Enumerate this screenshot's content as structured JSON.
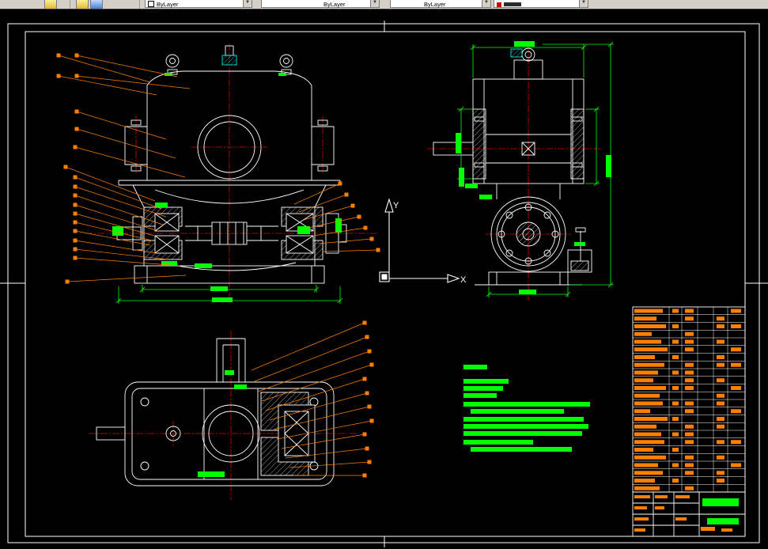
{
  "toolbar": {
    "combos": [
      {
        "label": "ByLayer"
      },
      {
        "label": "ByLayer"
      },
      {
        "label": "ByLayer"
      },
      {
        "label": ""
      }
    ]
  },
  "ucs": {
    "x_label": "X",
    "y_label": "Y"
  },
  "colors": {
    "line": "#ffffff",
    "centerline": "#dd0000",
    "dimension": "#00ff00",
    "annotation": "#ff7f00",
    "fitting": "#00ffff",
    "table_text": "#ff7f00"
  },
  "annotations": {
    "bars": [
      [
        142,
        286,
        14,
        12,
        "g"
      ],
      [
        196,
        256,
        16,
        6,
        "g"
      ],
      [
        204,
        330,
        20,
        6,
        "g"
      ],
      [
        246,
        333,
        22,
        6,
        "g"
      ],
      [
        266,
        362,
        22,
        6,
        "g"
      ],
      [
        268,
        376,
        26,
        6,
        "g"
      ],
      [
        376,
        286,
        16,
        10,
        "g"
      ],
      [
        424,
        276,
        8,
        18,
        "g"
      ],
      [
        208,
        92,
        10,
        4,
        "g"
      ],
      [
        352,
        92,
        10,
        4,
        "g"
      ],
      [
        650,
        52,
        26,
        7,
        "g"
      ],
      [
        576,
        168,
        7,
        26,
        "g"
      ],
      [
        580,
        212,
        7,
        24,
        "g"
      ],
      [
        766,
        196,
        7,
        28,
        "g"
      ],
      [
        606,
        246,
        16,
        6,
        "g"
      ],
      [
        588,
        232,
        16,
        6,
        "g"
      ],
      [
        726,
        306,
        14,
        5,
        "g"
      ],
      [
        656,
        366,
        22,
        6,
        "g"
      ],
      [
        250,
        596,
        34,
        7,
        "g"
      ],
      [
        296,
        486,
        16,
        6,
        "g"
      ],
      [
        284,
        468,
        12,
        6,
        "g"
      ],
      [
        586,
        461,
        30,
        6,
        "g"
      ],
      [
        586,
        479,
        57,
        6,
        "g"
      ],
      [
        586,
        488,
        50,
        6,
        "g"
      ],
      [
        586,
        497,
        42,
        6,
        "g"
      ],
      [
        586,
        508,
        160,
        6,
        "g"
      ],
      [
        595,
        517,
        118,
        6,
        "g"
      ],
      [
        586,
        527,
        152,
        6,
        "g"
      ],
      [
        586,
        536,
        158,
        6,
        "g"
      ],
      [
        586,
        545,
        150,
        6,
        "g"
      ],
      [
        586,
        556,
        88,
        6,
        "g"
      ],
      [
        595,
        565,
        128,
        6,
        "g"
      ],
      [
        888,
        630,
        46,
        10,
        "g"
      ],
      [
        894,
        655,
        40,
        8,
        "g"
      ],
      [
        802,
        626,
        20,
        4,
        "o"
      ],
      [
        802,
        640,
        16,
        4,
        "o"
      ],
      [
        802,
        654,
        18,
        4,
        "o"
      ],
      [
        802,
        668,
        14,
        4,
        "o"
      ],
      [
        828,
        626,
        16,
        4,
        "o"
      ],
      [
        828,
        640,
        12,
        4,
        "o"
      ],
      [
        854,
        626,
        18,
        4,
        "o"
      ],
      [
        854,
        654,
        14,
        4,
        "o"
      ],
      [
        886,
        666,
        18,
        5,
        "o"
      ],
      [
        912,
        668,
        14,
        4,
        "o"
      ]
    ],
    "leaders": [
      [
        74,
        70,
        190,
        104
      ],
      [
        97,
        70,
        224,
        97
      ],
      [
        74,
        96,
        198,
        120
      ],
      [
        97,
        96,
        240,
        112
      ],
      [
        97,
        141,
        210,
        176
      ],
      [
        97,
        163,
        222,
        200
      ],
      [
        95,
        186,
        234,
        224
      ],
      [
        83,
        211,
        196,
        254
      ],
      [
        95,
        224,
        204,
        264
      ],
      [
        95,
        236,
        210,
        274
      ],
      [
        95,
        247,
        206,
        284
      ],
      [
        95,
        259,
        200,
        292
      ],
      [
        95,
        270,
        195,
        298
      ],
      [
        95,
        281,
        192,
        304
      ],
      [
        95,
        292,
        190,
        310
      ],
      [
        95,
        304,
        198,
        320
      ],
      [
        95,
        315,
        212,
        328
      ],
      [
        95,
        326,
        228,
        336
      ],
      [
        85,
        356,
        235,
        348
      ],
      [
        430,
        232,
        372,
        258
      ],
      [
        438,
        246,
        378,
        268
      ],
      [
        446,
        260,
        384,
        278
      ],
      [
        454,
        274,
        390,
        288
      ],
      [
        462,
        288,
        396,
        298
      ],
      [
        470,
        302,
        402,
        308
      ],
      [
        478,
        316,
        408,
        318
      ],
      [
        461,
        408,
        318,
        468
      ],
      [
        464,
        426,
        322,
        482
      ],
      [
        467,
        444,
        326,
        495
      ],
      [
        470,
        461,
        331,
        507
      ],
      [
        461,
        479,
        336,
        519
      ],
      [
        464,
        497,
        341,
        531
      ],
      [
        467,
        514,
        346,
        543
      ],
      [
        470,
        532,
        351,
        555
      ],
      [
        461,
        549,
        356,
        567
      ],
      [
        464,
        567,
        361,
        579
      ],
      [
        467,
        584,
        366,
        591
      ],
      [
        461,
        601,
        371,
        601
      ]
    ]
  },
  "parts_table": {
    "rows": [
      [
        36,
        1,
        1,
        0,
        1
      ],
      [
        28,
        0,
        1,
        1,
        0
      ],
      [
        40,
        1,
        0,
        1,
        1
      ],
      [
        22,
        0,
        1,
        0,
        0
      ],
      [
        34,
        1,
        1,
        1,
        0
      ],
      [
        42,
        0,
        1,
        0,
        1
      ],
      [
        26,
        1,
        0,
        1,
        0
      ],
      [
        38,
        0,
        1,
        1,
        1
      ],
      [
        30,
        1,
        1,
        0,
        0
      ],
      [
        24,
        0,
        1,
        1,
        0
      ],
      [
        40,
        1,
        1,
        0,
        1
      ],
      [
        32,
        0,
        0,
        1,
        0
      ],
      [
        36,
        1,
        1,
        1,
        0
      ],
      [
        20,
        0,
        1,
        0,
        1
      ],
      [
        42,
        1,
        0,
        1,
        0
      ],
      [
        28,
        0,
        1,
        1,
        0
      ],
      [
        34,
        1,
        1,
        0,
        0
      ],
      [
        38,
        0,
        1,
        1,
        1
      ],
      [
        24,
        1,
        0,
        0,
        0
      ],
      [
        40,
        0,
        1,
        1,
        0
      ],
      [
        30,
        1,
        1,
        0,
        1
      ],
      [
        36,
        0,
        1,
        1,
        0
      ],
      [
        26,
        1,
        0,
        1,
        0
      ],
      [
        32,
        0,
        1,
        0,
        0
      ]
    ]
  }
}
